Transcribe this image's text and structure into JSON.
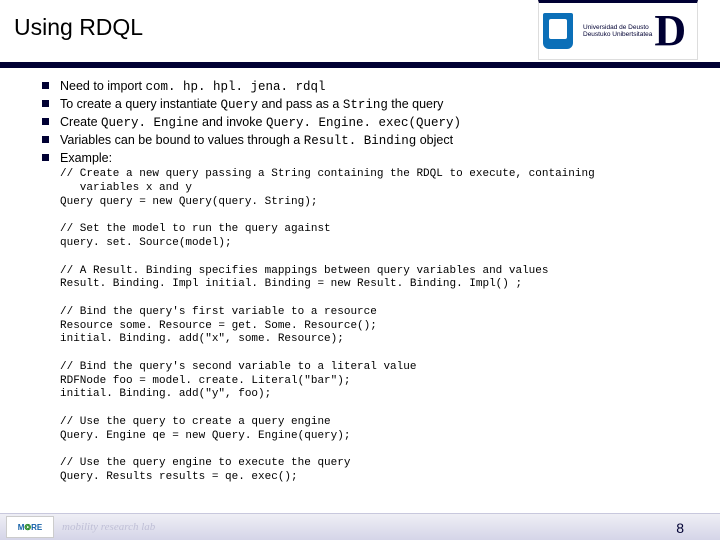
{
  "title": "Using RDQL",
  "logo": {
    "line1": "Universidad de Deusto",
    "line2": "Deustuko Unibertsitatea"
  },
  "bullets": [
    {
      "pre": "Need to import ",
      "code": "com. hp. hpl. jena. rdql",
      "post": ""
    },
    {
      "pre": "To create a query instantiate ",
      "code": "Query",
      "post": " and pass as a ",
      "code2": "String",
      "post2": " the query"
    },
    {
      "pre": "Create ",
      "code": "Query. Engine",
      "post": " and invoke ",
      "code2": "Query. Engine. exec(Query)",
      "post2": ""
    },
    {
      "pre": "Variables can be bound to values through a ",
      "code": "Result. Binding",
      "post": " object"
    },
    {
      "pre": "Example:",
      "code": "",
      "post": ""
    }
  ],
  "code": "// Create a new query passing a String containing the RDQL to execute, containing\n   variables x and y\nQuery query = new Query(query. String);\n\n// Set the model to run the query against\nquery. set. Source(model);\n\n// A Result. Binding specifies mappings between query variables and values\nResult. Binding. Impl initial. Binding = new Result. Binding. Impl() ;\n\n// Bind the query's first variable to a resource\nResource some. Resource = get. Some. Resource();\ninitial. Binding. add(\"x\", some. Resource);\n\n// Bind the query's second variable to a literal value\nRDFNode foo = model. create. Literal(\"bar\");\ninitial. Binding. add(\"y\", foo);\n\n// Use the query to create a query engine\nQuery. Engine qe = new Query. Engine(query);\n\n// Use the query engine to execute the query\nQuery. Results results = qe. exec();",
  "footer": {
    "logo": "M RE",
    "text": "mobility research lab"
  },
  "page": "8"
}
